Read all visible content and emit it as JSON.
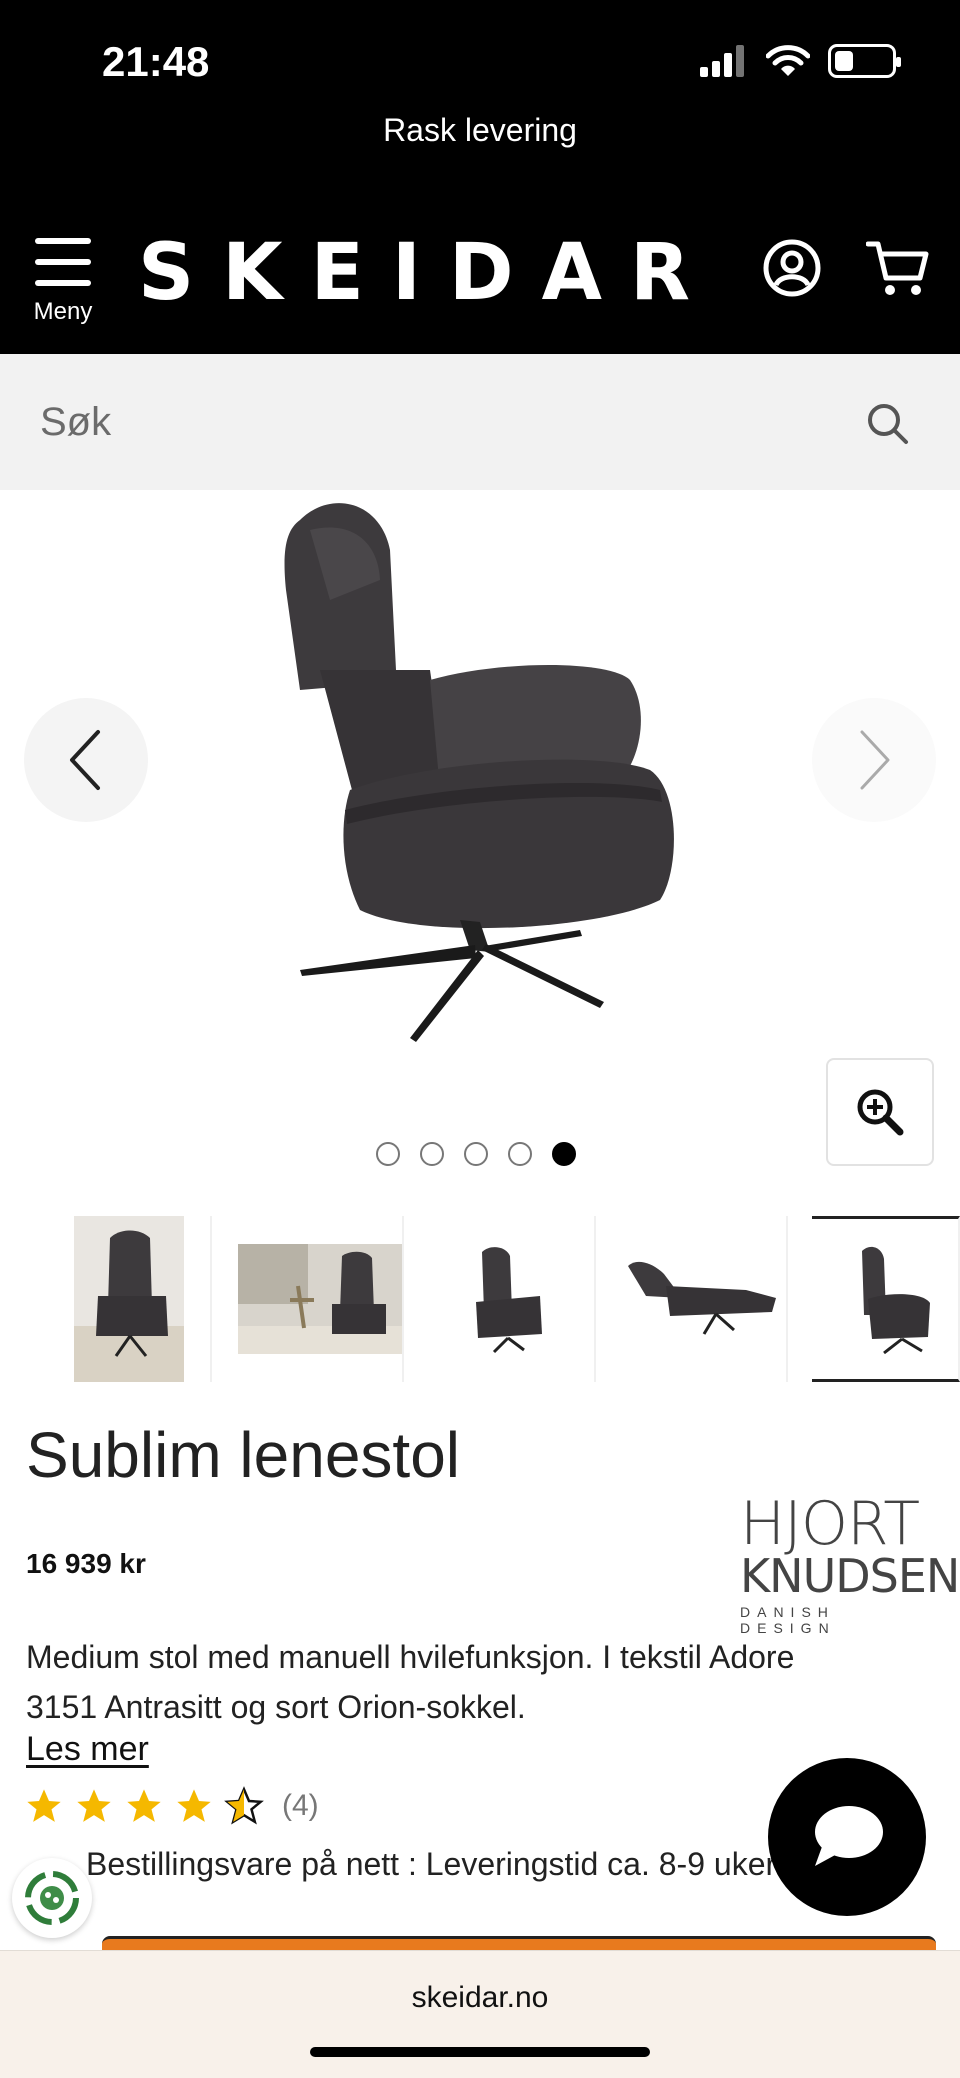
{
  "status_bar": {
    "time": "21:48"
  },
  "promo": {
    "text": "Rask levering"
  },
  "header": {
    "menu_label": "Meny",
    "logo": "SKEIDAR"
  },
  "search": {
    "placeholder": "Søk"
  },
  "gallery": {
    "dots_total": 5,
    "active_dot": 5,
    "thumbnails": [
      {
        "icon": "chair-front-photo"
      },
      {
        "icon": "chair-room-photo"
      },
      {
        "icon": "chair-angle-photo"
      },
      {
        "icon": "chair-reclined-photo"
      },
      {
        "icon": "chair-side-photo"
      }
    ]
  },
  "product": {
    "title": "Sublim lenestol",
    "price": "16 939 kr",
    "brand": {
      "line1": "HJORT",
      "line2": "KNUDSEN",
      "line3": "DANISH DESIGN"
    },
    "description": "Medium stol med manuell hvilefunksjon. I tekstil Adore 3151 Antrasitt og sort Orion-sokkel.",
    "read_more": "Les mer",
    "rating": {
      "value": 4.5,
      "max": 5,
      "count_text": "(4)"
    },
    "delivery": "Bestillingsvare på nett : Leveringstid ca. 8-9 uker"
  },
  "browser": {
    "url": "skeidar.no"
  },
  "colors": {
    "header_bg": "#000000",
    "star": "#f5b800",
    "cta": "#e87a1e",
    "browser_bg": "#f8f1ea"
  }
}
